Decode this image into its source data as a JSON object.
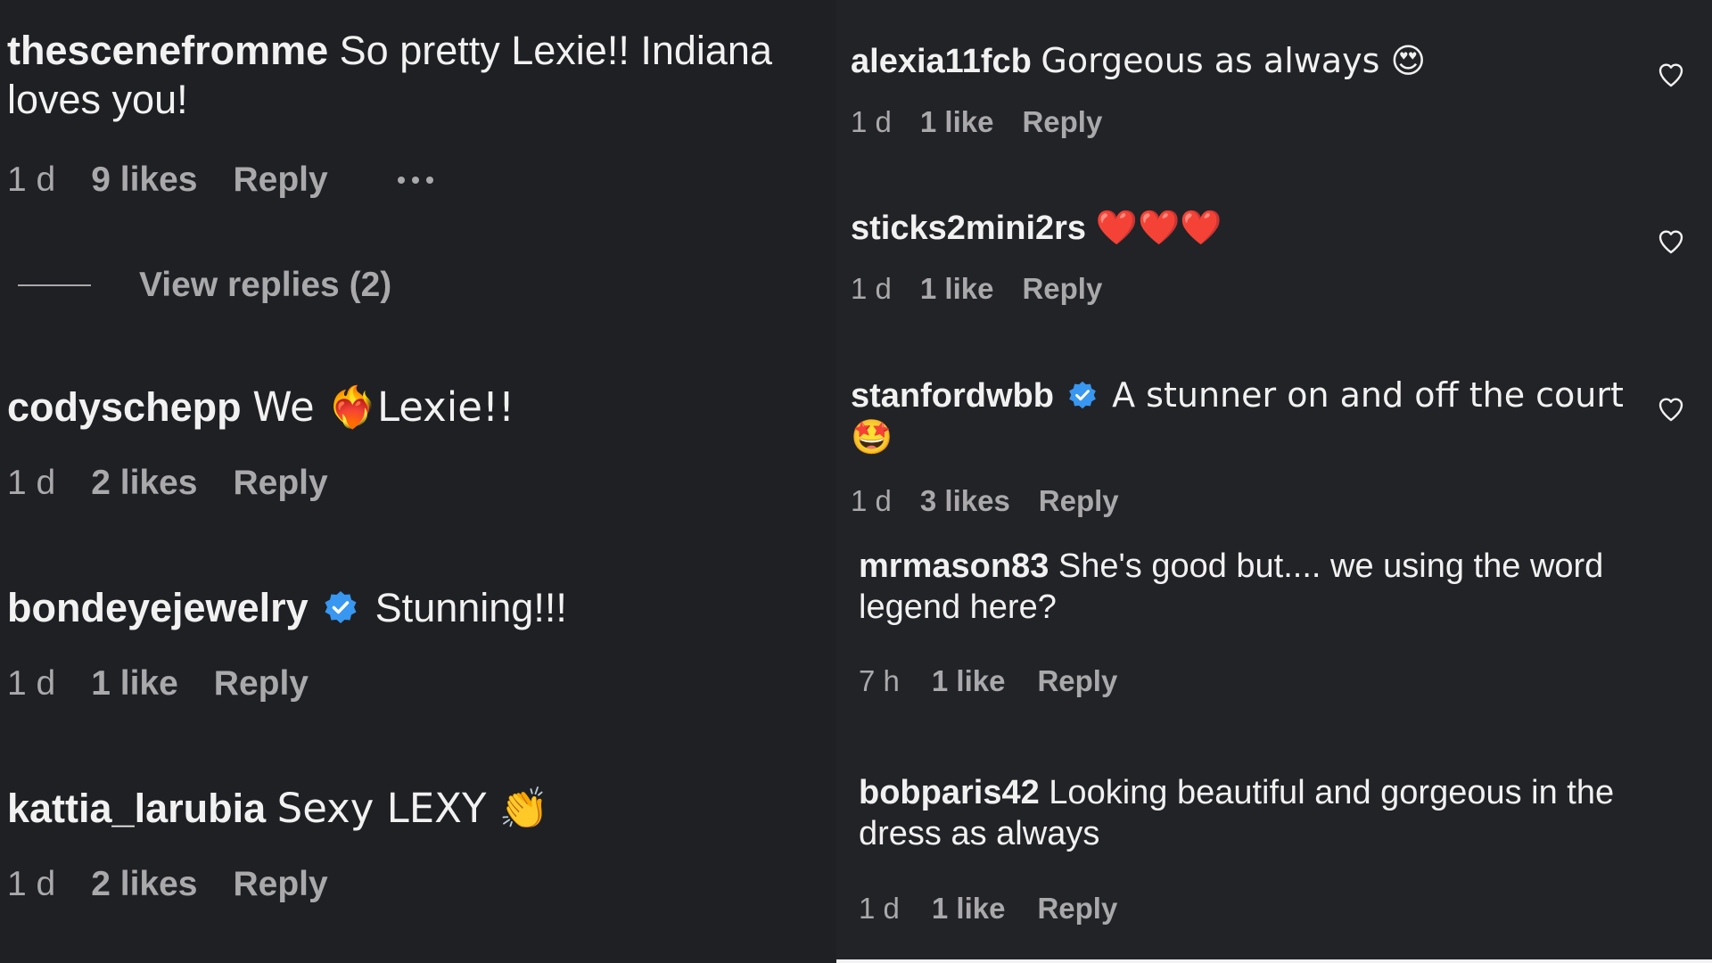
{
  "left_comments": [
    {
      "username": "thescenefromme",
      "text": "So pretty Lexie!! Indiana loves you!",
      "time": "1 d",
      "likes": "9 likes",
      "reply": "Reply"
    },
    {
      "username": "codyschepp",
      "text": "We ❤️‍🔥Lexie!!",
      "time": "1 d",
      "likes": "2 likes",
      "reply": "Reply"
    },
    {
      "username": "bondeyejewelry",
      "text": "Stunning!!!",
      "time": "1 d",
      "likes": "1 like",
      "reply": "Reply"
    },
    {
      "username": "kattia_larubia",
      "text": "Sexy LEXY 👏",
      "time": "1 d",
      "likes": "2 likes",
      "reply": "Reply"
    }
  ],
  "view_replies": "View replies (2)",
  "right_comments": [
    {
      "username": "alexia11fcb",
      "text": "Gorgeous as always 😍",
      "time": "1 d",
      "likes": "1 like",
      "reply": "Reply"
    },
    {
      "username": "sticks2mini2rs",
      "text": "❤️❤️❤️",
      "time": "1 d",
      "likes": "1 like",
      "reply": "Reply"
    },
    {
      "username": "stanfordwbb",
      "text": "A stunner on and off the court 🤩",
      "time": "1 d",
      "likes": "3 likes",
      "reply": "Reply"
    },
    {
      "username": "mrmason83",
      "text": "She's good but.... we using the word legend here?",
      "time": "7 h",
      "likes": "1 like",
      "reply": "Reply"
    },
    {
      "username": "bobparis42",
      "text": "Looking beautiful and gorgeous in the dress as always",
      "time": "1 d",
      "likes": "1 like",
      "reply": "Reply"
    }
  ],
  "colors": {
    "background": "#1f2024",
    "meta_text": "#a9a9ab",
    "verified": "#3897f0"
  },
  "icons": [
    "verified-badge-icon",
    "heart-outline-icon",
    "more-options-icon"
  ]
}
